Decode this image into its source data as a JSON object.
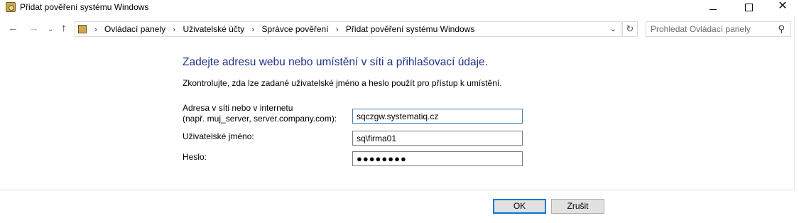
{
  "window": {
    "title": "Přidat pověření systému Windows",
    "minimize_glyph": "",
    "close_glyph": "✕",
    "icon": "credential-manager-icon"
  },
  "nav": {
    "back_glyph": "←",
    "forward_glyph": "→",
    "recent_glyph": "⌄",
    "up_glyph": "↑",
    "breadcrumbs": [
      "Ovládací panely",
      "Uživatelské účty",
      "Správce pověření",
      "Přidat pověření systému Windows"
    ],
    "separator": "›",
    "dropdown_glyph": "⌄",
    "refresh_glyph": "↻"
  },
  "search": {
    "placeholder": "Prohledat Ovládací panely",
    "icon_glyph": "⚲"
  },
  "form": {
    "heading": "Zadejte adresu webu nebo umístění v síti a přihlašovací údaje.",
    "description": "Zkontrolujte, zda lze zadané uživatelské jméno a heslo použít pro přístup k umístění.",
    "address_label_line1": "Adresa v síti nebo v internetu",
    "address_label_line2": "(např. muj_server, server.company.com):",
    "address_value": "sqczgw.systematiq.cz",
    "username_label": "Uživatelské jméno:",
    "username_value": "sq\\firma01",
    "password_label": "Heslo:",
    "password_value": "●●●●●●●●"
  },
  "buttons": {
    "ok": "OK",
    "cancel": "Zrušit"
  },
  "colors": {
    "heading": "#1e3287",
    "focus_border": "#3c7fb1",
    "default_button_border": "#0078d7"
  }
}
